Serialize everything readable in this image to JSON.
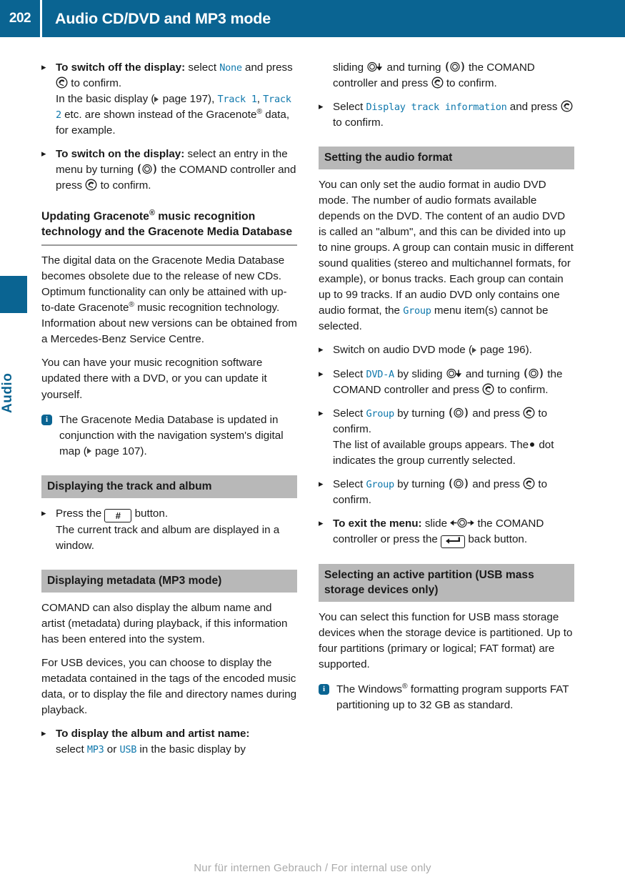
{
  "header": {
    "page_number": "202",
    "title": "Audio CD/DVD and MP3 mode"
  },
  "chapter_tab": {
    "label": "Audio"
  },
  "footer": {
    "text": "Nur für internen Gebrauch / For internal use only"
  },
  "icons": {
    "press": "press-controller-icon",
    "turn": "turn-controller-icon",
    "slide_down": "slide-down-controller-icon",
    "slide_horizontal": "slide-horizontal-controller-icon",
    "hash_button": "#",
    "back_button": "back-button-icon",
    "info": "i"
  },
  "left_column": {
    "step_switch_off": {
      "lead": "To switch off the display:",
      "t1": " select ",
      "v1": "None",
      "t2": " and press ",
      "t3": " to confirm.",
      "l2_a": "In the basic display (",
      "l2_b": " page 197), ",
      "v2": "Track 1",
      "l2_c": ", ",
      "v3": "Track 2",
      "l2_d": " etc. are shown instead of the Gracenote",
      "l2_sup": "®",
      "l2_e": " data, for example."
    },
    "step_switch_on": {
      "lead": "To switch on the display:",
      "t1": " select an entry in the menu by turning ",
      "t2": " the COMAND controller and press ",
      "t3": " to confirm."
    },
    "subhead": {
      "part1": "Updating Gracenote",
      "sup": "®",
      "part2": " music recognition technology and the Gracenote Media Database"
    },
    "para1": {
      "a": "The digital data on the Gracenote Media Database becomes obsolete due to the release of new CDs. Optimum functionality can only be attained with up-to-date Gracenote",
      "sup": "®",
      "b": " music recognition technology. Information about new versions can be obtained from a Mercedes-Benz Service Centre."
    },
    "para2": "You can have your music recognition software updated there with a DVD, or you can update it yourself.",
    "note1": {
      "a": "The Gracenote Media Database is updated in conjunction with the navigation system's digital map (",
      "b": " page 107)."
    },
    "section_track_album": {
      "heading": "Displaying the track and album",
      "step": {
        "a": "Press the ",
        "btn": "#",
        "b": " button.",
        "c": "The current track and album are displayed in a window."
      }
    },
    "section_metadata": {
      "heading": "Displaying metadata (MP3 mode)",
      "para1": "COMAND can also display the album name and artist (metadata) during playback, if this information has been entered into the system.",
      "para2": "For USB devices, you can choose to display the metadata contained in the tags of the encoded music data, or to display the file and directory names during playback.",
      "step": {
        "lead": "To display the album and artist name:",
        "a": " select ",
        "v1": "MP3",
        "b": " or ",
        "v2": "USB",
        "c": " in the basic display by"
      }
    }
  },
  "right_column": {
    "cont_step": {
      "a": "sliding ",
      "b": " and turning ",
      "c": " the COMAND controller and press ",
      "d": " to confirm."
    },
    "step_display_track": {
      "a": "Select ",
      "v1": "Display track information",
      "b": " and press ",
      "c": " to confirm."
    },
    "section_audio_format": {
      "heading": "Setting the audio format",
      "para1": {
        "a": "You can only set the audio format in audio DVD mode. The number of audio formats available depends on the DVD. The content of an audio DVD is called an \"album\", and this can be divided into up to nine groups. A group can contain music in different sound qualities (stereo and multichannel formats, for example), or bonus tracks. Each group can contain up to 99 tracks. If an audio DVD only contains one audio format, the ",
        "v1": "Group",
        "b": " menu item(s) cannot be selected."
      },
      "step_switch_on_dvd": {
        "a": "Switch on audio DVD mode (",
        "b": " page 196)."
      },
      "step_select_dvda": {
        "a": "Select ",
        "v1": "DVD-A",
        "b": " by sliding ",
        "c": " and turning ",
        "d": " the COMAND controller and press ",
        "e": " to confirm."
      },
      "step_select_group1": {
        "a": "Select ",
        "v1": "Group",
        "b": " by turning ",
        "c": " and press ",
        "d": " to confirm.",
        "e": "The list of available groups appears. The",
        "f": " dot indicates the group currently selected."
      },
      "step_select_group2": {
        "a": "Select ",
        "v1": "Group",
        "b": " by turning ",
        "c": " and press ",
        "d": " to confirm."
      },
      "step_exit": {
        "lead": "To exit the menu:",
        "a": " slide ",
        "b": " the COMAND controller or press the ",
        "c": " back button."
      }
    },
    "section_partition": {
      "heading": "Selecting an active partition (USB mass storage devices only)",
      "para1": "You can select this function for USB mass storage devices when the storage device is partitioned. Up to four partitions (primary or logical; FAT format) are supported.",
      "note": {
        "a": "The Windows",
        "sup": "®",
        "b": " formatting program supports FAT partitioning up to 32 GB as standard."
      }
    }
  }
}
